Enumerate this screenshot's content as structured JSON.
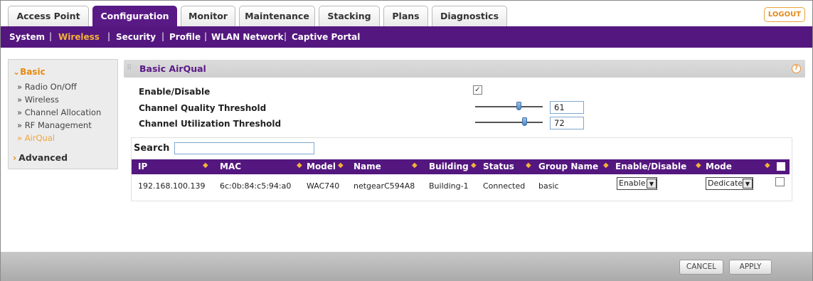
{
  "tabs": [
    "Access Point",
    "Configuration",
    "Monitor",
    "Maintenance",
    "Stacking",
    "Plans",
    "Diagnostics"
  ],
  "active_tab": "Configuration",
  "logout_label": "LOGOUT",
  "subnav": [
    "System",
    "Wireless",
    "Security",
    "Profile",
    "WLAN Network",
    "Captive Portal"
  ],
  "subnav_sep": "|",
  "active_subnav": "Wireless",
  "leftnav": {
    "basic_label": "Basic",
    "items": [
      "» Radio On/Off",
      "» Wireless",
      "» Channel Allocation",
      "» RF Management",
      "» AirQual"
    ],
    "active_item": "» AirQual",
    "advanced_label": "Advanced"
  },
  "panel": {
    "title": "Basic AirQual",
    "help": "?"
  },
  "settings": {
    "enable_label": "Enable/Disable",
    "enable_checked": true,
    "quality_label": "Channel Quality Threshold",
    "quality_value": "61",
    "utilization_label": "Channel Utilization Threshold",
    "utilization_value": "72"
  },
  "search": {
    "label": "Search",
    "value": ""
  },
  "table": {
    "headers": [
      "IP",
      "MAC",
      "Model",
      "Name",
      "Building",
      "Status",
      "Group Name",
      "Enable/Disable",
      "Mode"
    ],
    "sort_glyph": "◆",
    "rows": [
      {
        "ip": "192.168.100.139",
        "mac": "6c:0b:84:c5:94:a0",
        "model": "WAC740",
        "name": "netgearC594A8",
        "building": "Building-1",
        "status": "Connected",
        "group": "basic",
        "enable": "Enable",
        "mode": "Dedicated"
      }
    ]
  },
  "buttons": {
    "cancel": "CANCEL",
    "apply": "APPLY"
  },
  "colors": {
    "brand_purple": "#54177f",
    "accent_orange": "#f3b23a"
  }
}
